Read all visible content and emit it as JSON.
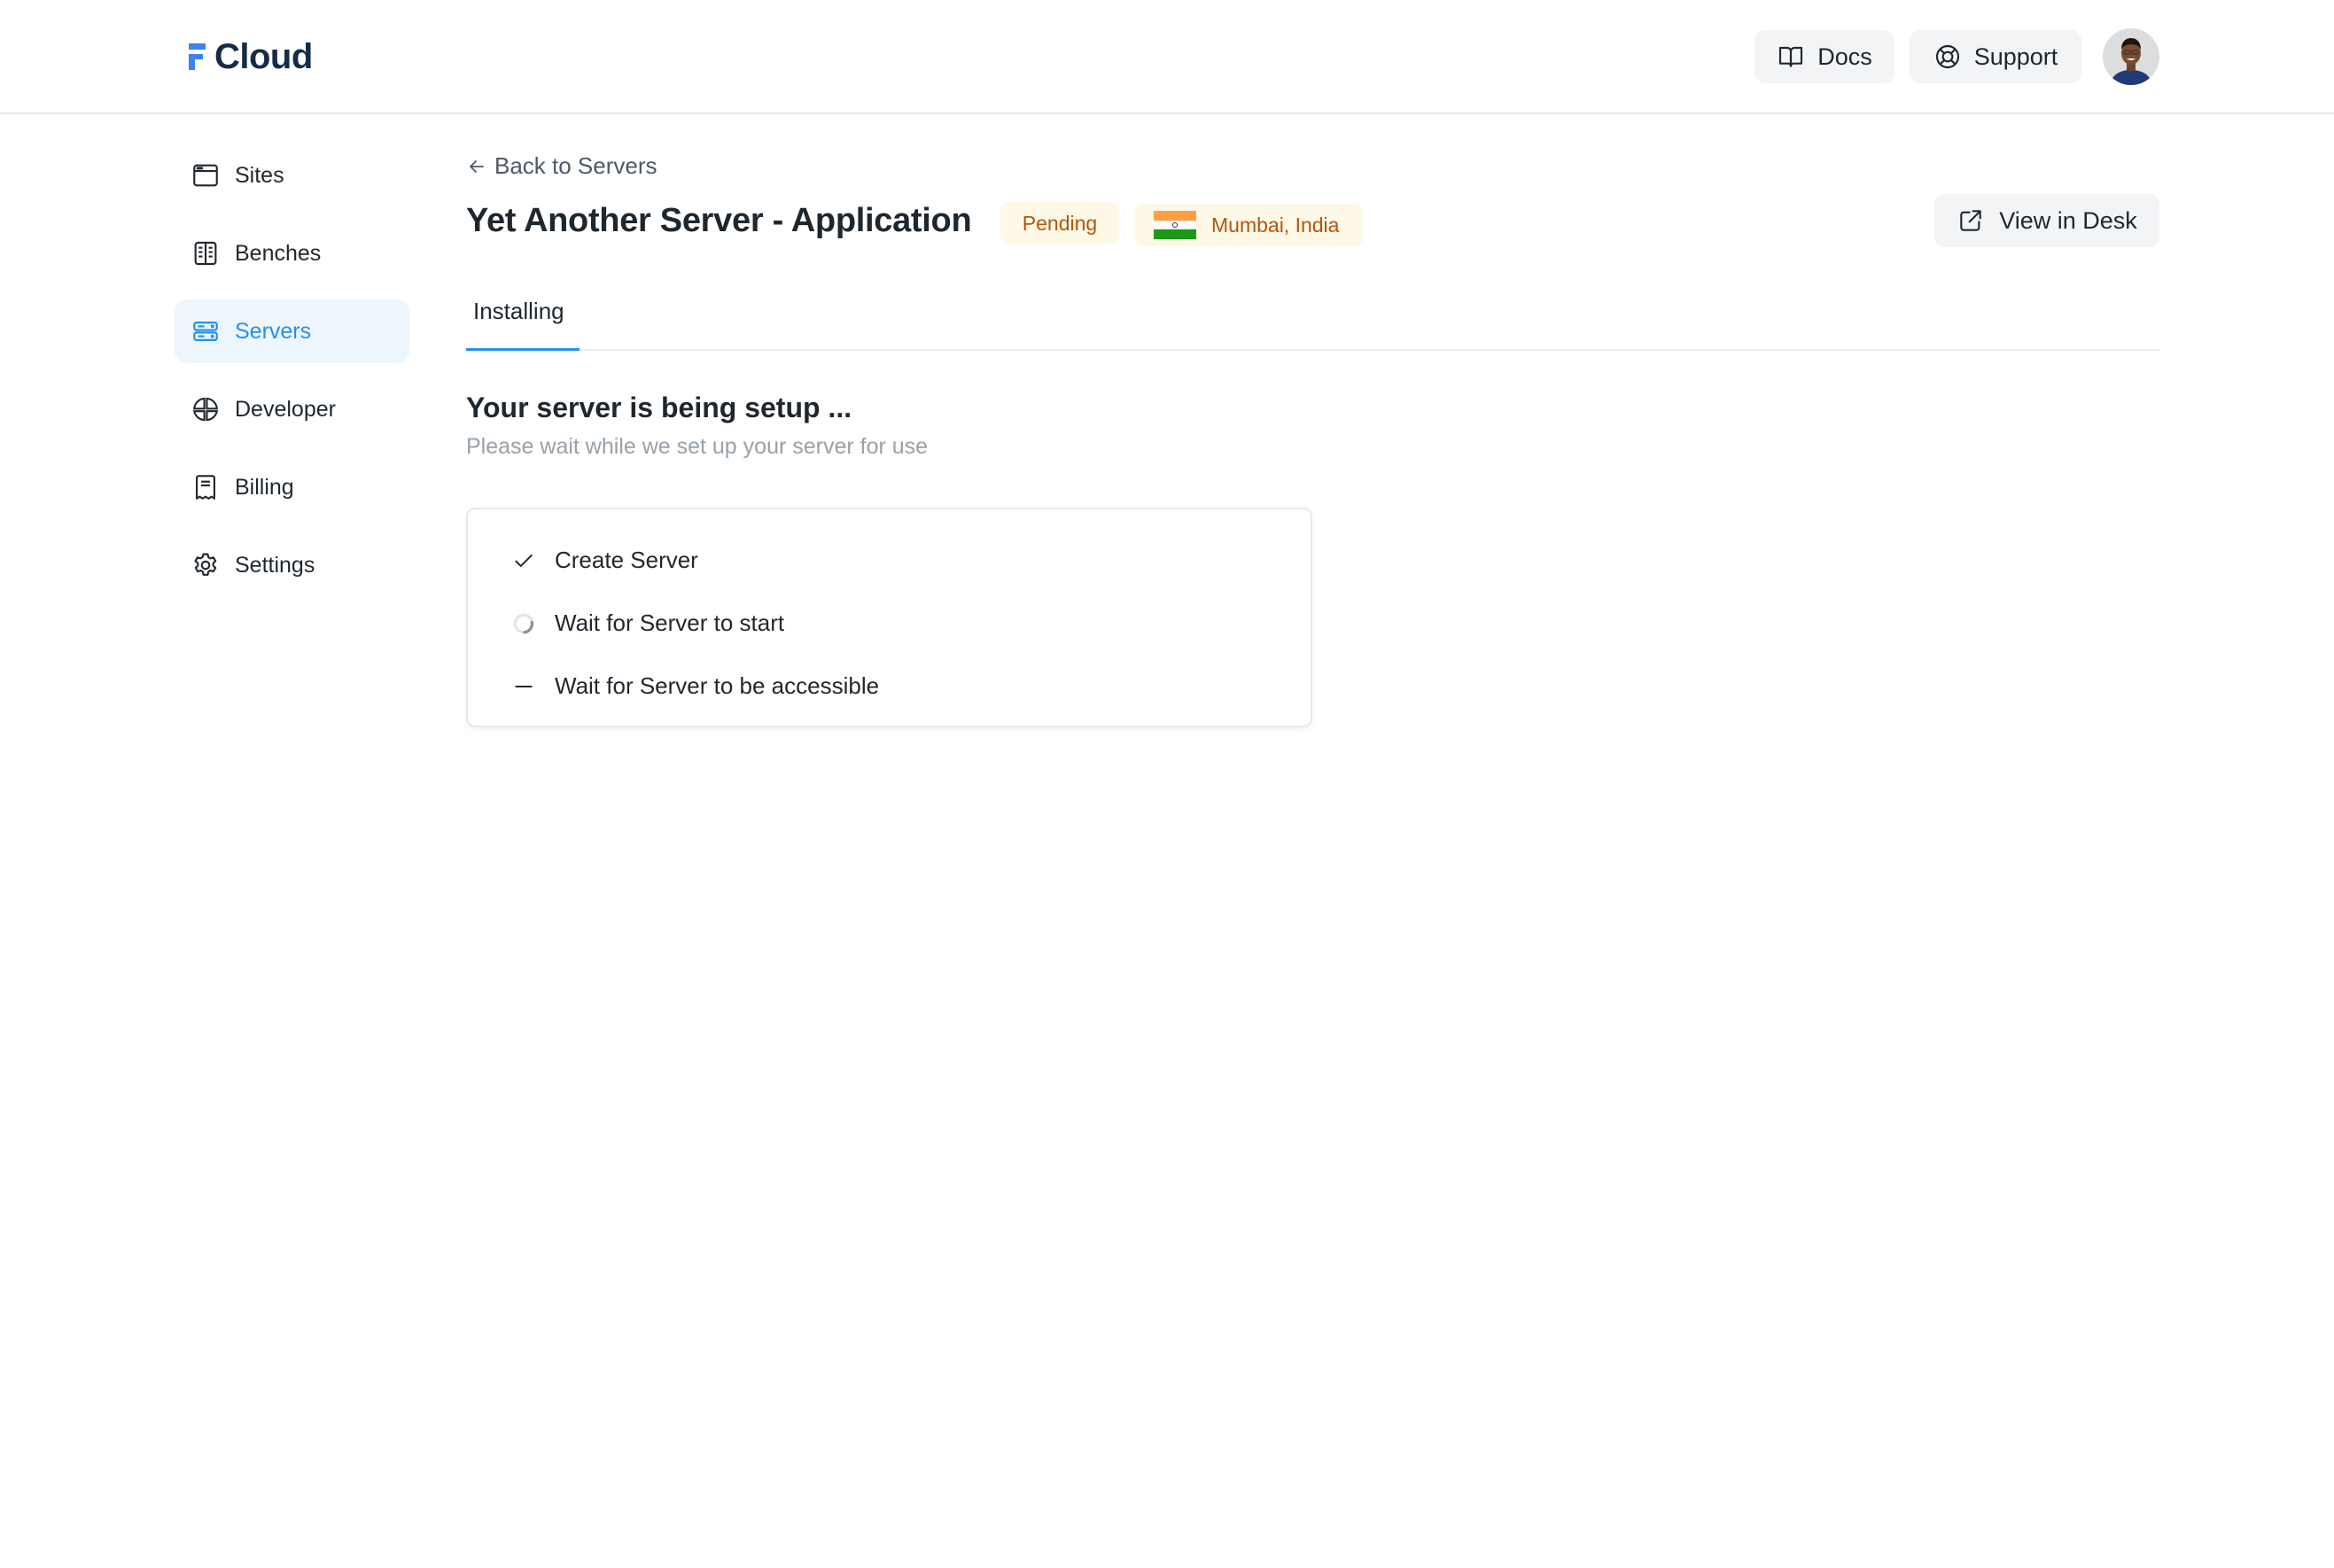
{
  "header": {
    "logo_text": "Cloud",
    "docs_label": "Docs",
    "support_label": "Support",
    "avatar_alt": "User avatar"
  },
  "sidebar": {
    "items": [
      {
        "label": "Sites",
        "icon": "browser-window-icon",
        "active": false
      },
      {
        "label": "Benches",
        "icon": "bench-panels-icon",
        "active": false
      },
      {
        "label": "Servers",
        "icon": "server-icon",
        "active": true
      },
      {
        "label": "Developer",
        "icon": "developer-icon",
        "active": false
      },
      {
        "label": "Billing",
        "icon": "receipt-icon",
        "active": false
      },
      {
        "label": "Settings",
        "icon": "gear-icon",
        "active": false
      }
    ]
  },
  "page": {
    "back_label": "Back to Servers",
    "title": "Yet Another Server - Application",
    "status_badge": "Pending",
    "location": "Mumbai, India",
    "location_flag": "india-flag",
    "view_in_desk_label": "View in Desk",
    "tabs": [
      {
        "label": "Installing",
        "active": true
      }
    ],
    "setup": {
      "title": "Your server is being setup ...",
      "subtitle": "Please wait while we set up your server for use",
      "steps": [
        {
          "label": "Create Server",
          "status": "completed"
        },
        {
          "label": "Wait for Server to start",
          "status": "running"
        },
        {
          "label": "Wait for Server to be accessible",
          "status": "pending"
        }
      ]
    }
  },
  "colors": {
    "accent": "#2490ef",
    "active_nav_bg": "#eef6fd",
    "badge_bg": "#fef9e7",
    "badge_text": "#b4550b",
    "logo_blue": "#3b82f6",
    "logo_text": "#142c47"
  }
}
